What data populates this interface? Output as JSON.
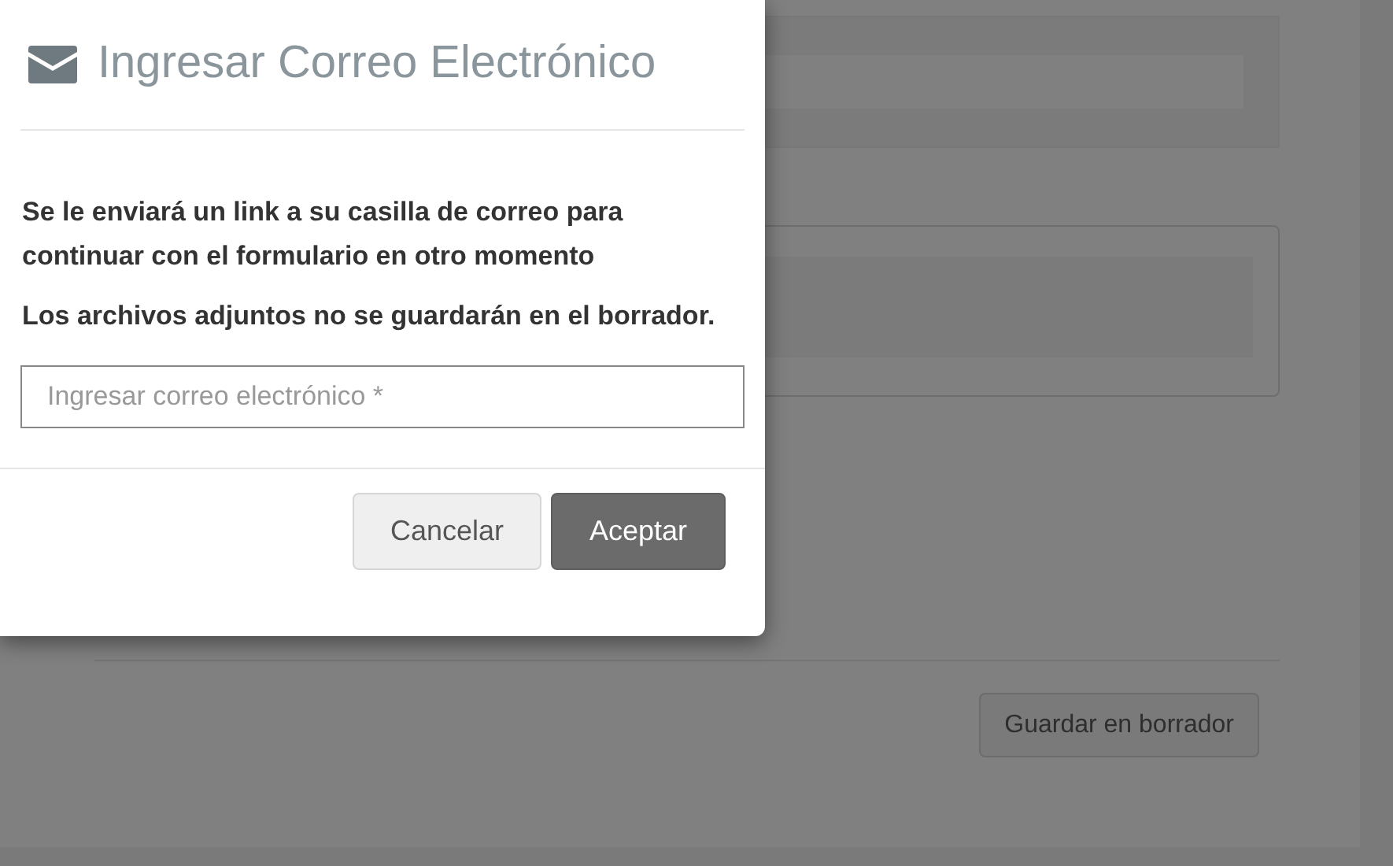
{
  "background_page": {
    "save_draft_button": "Guardar en borrador"
  },
  "modal": {
    "title": "Ingresar Correo Electrónico",
    "paragraphs": [
      "Se le enviará un link a su casilla de correo para continuar con el formulario en otro momento",
      "Los archivos adjuntos no se guardarán en el borrador."
    ],
    "email_field": {
      "placeholder": "Ingresar correo electrónico *"
    },
    "buttons": [
      {
        "label": "Cancelar",
        "kind": "secondary"
      },
      {
        "label": "Aceptar",
        "kind": "primary"
      }
    ]
  }
}
